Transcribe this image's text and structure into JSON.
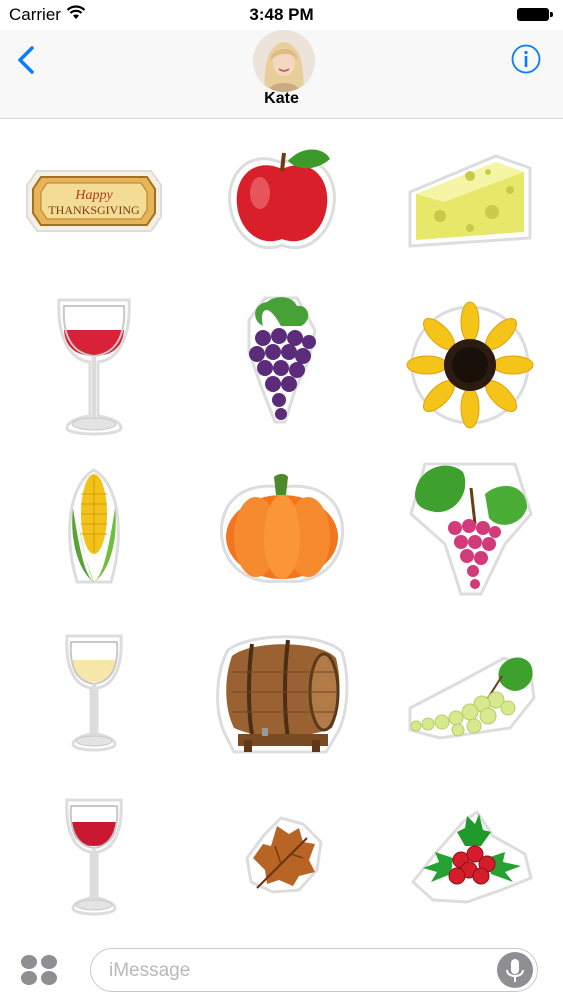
{
  "status_bar": {
    "carrier": "Carrier",
    "time": "3:48 PM"
  },
  "header": {
    "contact_name": "Kate"
  },
  "stickers": [
    {
      "name": "happy-thanksgiving-sticker",
      "line1": "Happy",
      "line2": "THANKSGIVING"
    },
    {
      "name": "apple-sticker"
    },
    {
      "name": "cheese-sticker"
    },
    {
      "name": "red-wine-glass-sticker"
    },
    {
      "name": "purple-grapes-sticker"
    },
    {
      "name": "sunflower-sticker"
    },
    {
      "name": "corn-sticker"
    },
    {
      "name": "pumpkin-sticker"
    },
    {
      "name": "red-grapes-vine-sticker"
    },
    {
      "name": "white-wine-glass-sticker"
    },
    {
      "name": "wine-barrel-sticker"
    },
    {
      "name": "green-grapes-sticker"
    },
    {
      "name": "red-wine-glass-small-sticker"
    },
    {
      "name": "autumn-leaf-sticker"
    },
    {
      "name": "holly-berries-sticker"
    }
  ],
  "message_input": {
    "placeholder": "iMessage"
  },
  "icons": {
    "back": "chevron-left-icon",
    "info": "info-icon",
    "apps": "app-drawer-icon",
    "mic": "microphone-icon",
    "wifi": "wifi-icon",
    "battery": "battery-icon"
  },
  "colors": {
    "accent": "#0a7aff",
    "header_bg": "#f8f8f8",
    "placeholder": "#b8b8bd"
  }
}
